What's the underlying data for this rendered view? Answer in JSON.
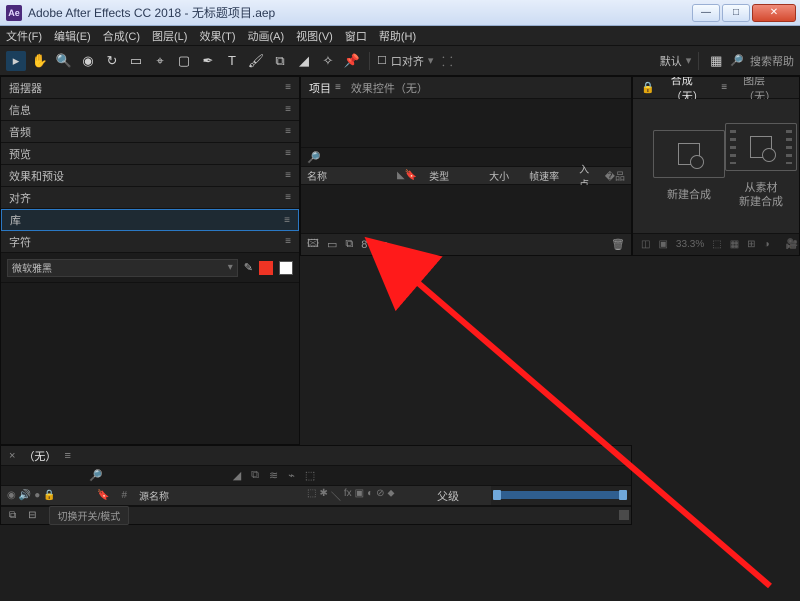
{
  "window": {
    "title": "Adobe After Effects CC 2018 - 无标题项目.aep",
    "app_badge": "Ae"
  },
  "menu": [
    "文件(F)",
    "编辑(E)",
    "合成(C)",
    "图层(L)",
    "效果(T)",
    "动画(A)",
    "视图(V)",
    "窗口",
    "帮助(H)"
  ],
  "toolbar": {
    "snap_label": "口对齐",
    "workspace_label": "默认",
    "search_placeholder": "搜索帮助"
  },
  "project_panel": {
    "tabs": {
      "project": "项目",
      "effect_controls": "效果控件（无）"
    },
    "columns": [
      "名称",
      "类型",
      "大小",
      "帧速率",
      "入点"
    ],
    "bpc": "8 bpc"
  },
  "viewer": {
    "tabs": {
      "comp": "合成（无）",
      "layer": "图层（无）"
    },
    "lock_icon": "🔒",
    "new_comp_label": "新建合成",
    "from_footage_label": "从素材\n新建合成",
    "zoom": "33.3%"
  },
  "right_panels": {
    "wiggler": "摇摆器",
    "info": "信息",
    "audio": "音频",
    "preview": "预览",
    "effects": "效果和预设",
    "align": "对齐",
    "libraries": "库",
    "character": "字符",
    "font_name": "微软雅黑"
  },
  "timeline": {
    "tab": "（无）",
    "col_source": "源名称",
    "col_parent": "父级",
    "switches_btn": "切换开关/模式"
  }
}
